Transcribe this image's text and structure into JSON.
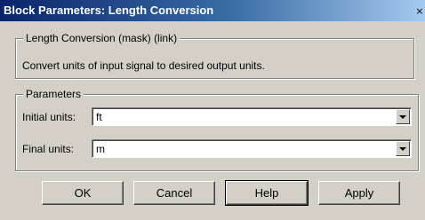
{
  "window": {
    "title": "Block Parameters: Length Conversion",
    "close_symbol": "×"
  },
  "mask_group": {
    "legend": "Length Conversion (mask) (link)",
    "description": "Convert units of input signal to desired output units."
  },
  "params_group": {
    "legend": "Parameters",
    "initial_units": {
      "label": "Initial units:",
      "value": "ft"
    },
    "final_units": {
      "label": "Final units:",
      "value": "m"
    }
  },
  "buttons": {
    "ok": "OK",
    "cancel": "Cancel",
    "help": "Help",
    "apply": "Apply"
  },
  "icons": {
    "close": "close-icon",
    "dropdown": "chevron-down-icon"
  }
}
